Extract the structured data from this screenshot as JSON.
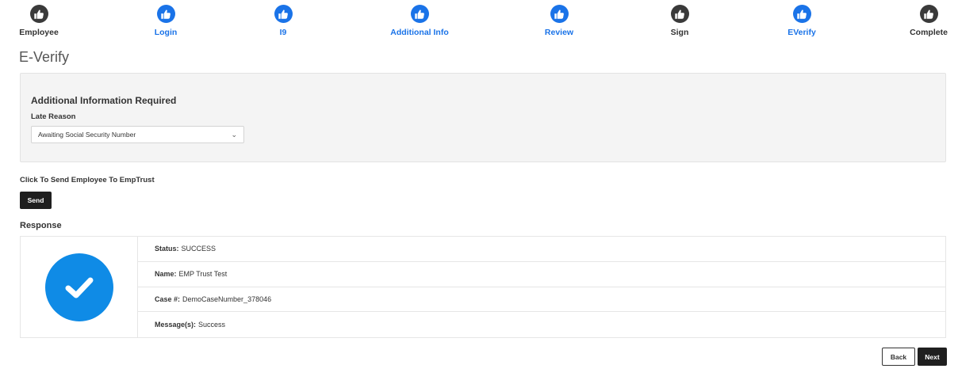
{
  "colors": {
    "step_complete": "#1a73e8",
    "step_incomplete": "#3a3a3a",
    "success": "#0f8be6",
    "button_dark": "#1f1f1f"
  },
  "stepper": {
    "steps": [
      {
        "label": "Employee",
        "state": "incomplete",
        "icon": "thumbs-up-icon"
      },
      {
        "label": "Login",
        "state": "complete",
        "icon": "thumbs-up-icon"
      },
      {
        "label": "I9",
        "state": "complete",
        "icon": "thumbs-up-icon"
      },
      {
        "label": "Additional Info",
        "state": "complete",
        "icon": "thumbs-up-icon"
      },
      {
        "label": "Review",
        "state": "complete",
        "icon": "thumbs-up-icon"
      },
      {
        "label": "Sign",
        "state": "incomplete",
        "icon": "thumbs-up-icon"
      },
      {
        "label": "EVerify",
        "state": "complete",
        "icon": "thumbs-up-icon"
      },
      {
        "label": "Complete",
        "state": "incomplete",
        "icon": "thumbs-up-icon"
      }
    ]
  },
  "page": {
    "title": "E-Verify"
  },
  "info_panel": {
    "heading": "Additional Information Required",
    "late_reason_label": "Late Reason",
    "late_reason_value": "Awaiting Social Security Number"
  },
  "send": {
    "prompt": "Click To Send Employee To EmpTrust",
    "button_label": "Send"
  },
  "response": {
    "title": "Response",
    "icon": "check-circle-icon",
    "rows": [
      {
        "label": "Status:",
        "value": "SUCCESS"
      },
      {
        "label": "Name:",
        "value": "EMP Trust Test"
      },
      {
        "label": "Case #:",
        "value": "DemoCaseNumber_378046"
      },
      {
        "label": "Message(s):",
        "value": "Success"
      }
    ]
  },
  "nav": {
    "back_label": "Back",
    "next_label": "Next"
  }
}
